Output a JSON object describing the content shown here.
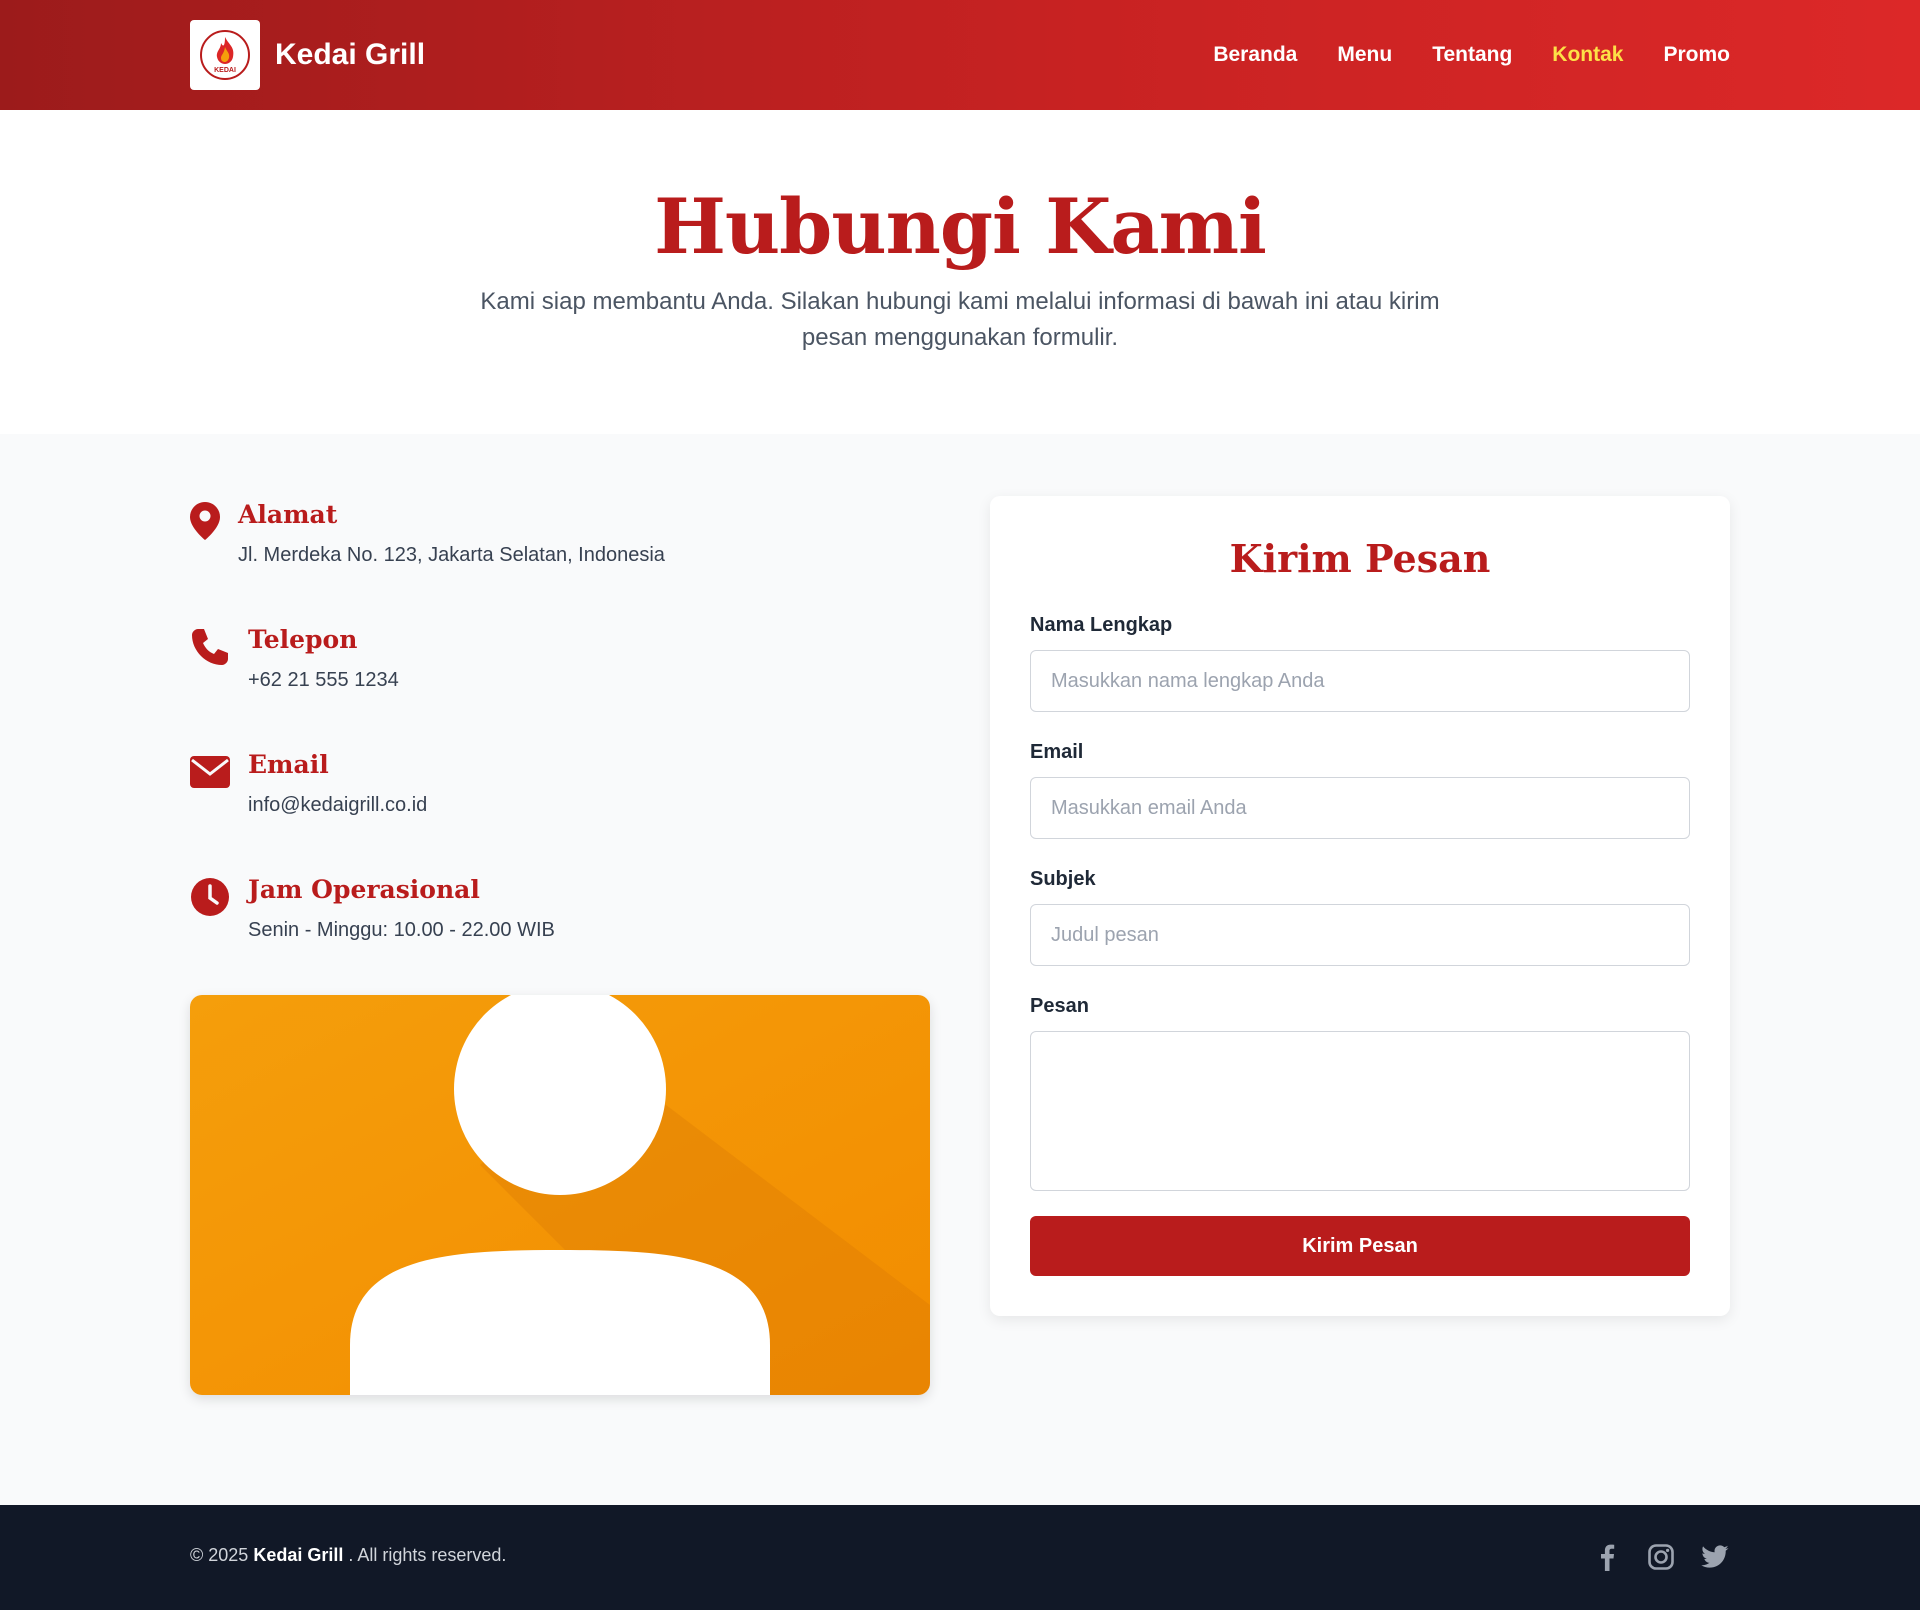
{
  "header": {
    "brand_name": "Kedai Grill",
    "logo_text": "KEDAI",
    "nav": [
      {
        "label": "Beranda"
      },
      {
        "label": "Menu"
      },
      {
        "label": "Tentang"
      },
      {
        "label": "Kontak",
        "active": true
      },
      {
        "label": "Promo"
      }
    ],
    "active_nav_color": "#fde047"
  },
  "hero": {
    "title": "Hubungi Kami",
    "subtitle": "Kami siap membantu Anda. Silakan hubungi kami melalui informasi di bawah ini atau kirim pesan menggunakan formulir."
  },
  "info": [
    {
      "icon": "map-pin-icon",
      "title": "Alamat",
      "text": "Jl. Merdeka No. 123, Jakarta Selatan, Indonesia"
    },
    {
      "icon": "phone-icon",
      "title": "Telepon",
      "text": "+62 21 555 1234"
    },
    {
      "icon": "envelope-icon",
      "title": "Email",
      "text": "info@kedaigrill.co.id"
    },
    {
      "icon": "clock-icon",
      "title": "Jam Operasional",
      "text": "Senin - Minggu: 10.00 - 22.00 WIB"
    }
  ],
  "map_image": {
    "icon": "person-placeholder-icon",
    "bg_color": "#f59e0b"
  },
  "form": {
    "title": "Kirim Pesan",
    "fields": {
      "name": {
        "label": "Nama Lengkap",
        "placeholder": "Masukkan nama lengkap Anda",
        "value": ""
      },
      "email": {
        "label": "Email",
        "placeholder": "Masukkan email Anda",
        "value": ""
      },
      "subject": {
        "label": "Subjek",
        "placeholder": "Judul pesan",
        "value": ""
      },
      "message": {
        "label": "Pesan",
        "placeholder": "",
        "value": ""
      }
    },
    "submit_label": "Kirim Pesan"
  },
  "footer": {
    "copyright_prefix": "© 2025",
    "brand": "Kedai Grill",
    "copyright_suffix": ". All rights reserved.",
    "socials": [
      "facebook-icon",
      "instagram-icon",
      "twitter-icon"
    ]
  },
  "colors": {
    "primary": "#b91c1c",
    "header_gradient_start": "#9c1b1b",
    "header_gradient_end": "#dc2828",
    "footer_bg": "#111827"
  }
}
